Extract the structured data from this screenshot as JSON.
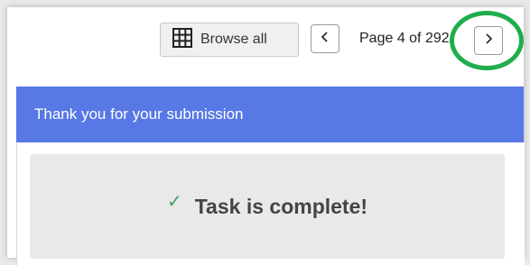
{
  "toolbar": {
    "browse_label": "Browse all",
    "page_indicator": "Page 4 of 292"
  },
  "banner": {
    "text": "Thank you for your submission"
  },
  "status": {
    "message": "Task is complete!"
  },
  "colors": {
    "banner_bg": "#5878e6",
    "highlight_ring": "#1fae4b",
    "check": "#3aa55d"
  },
  "icons": {
    "browse": "grid-icon",
    "prev": "chevron-left-icon",
    "next": "chevron-right-icon",
    "status": "checkmark-icon"
  }
}
